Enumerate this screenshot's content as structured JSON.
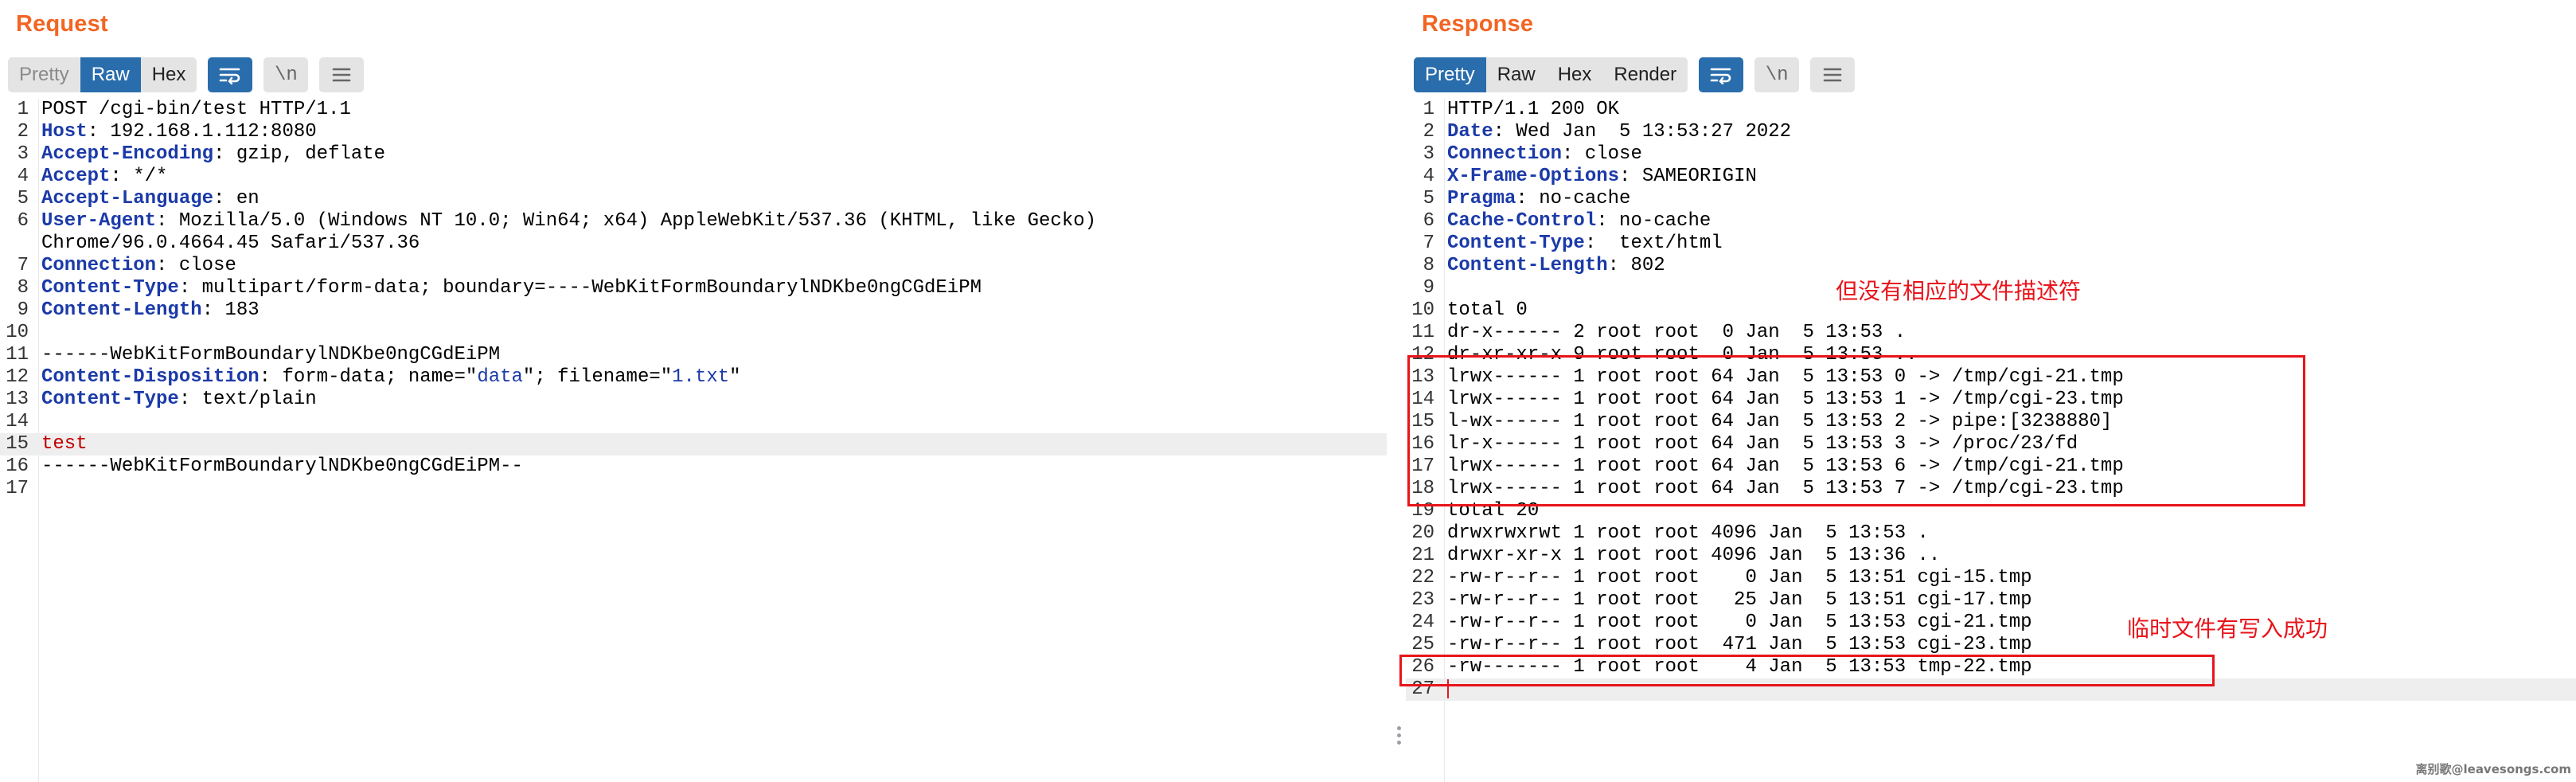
{
  "request": {
    "title": "Request",
    "tabs": [
      "Pretty",
      "Raw",
      "Hex"
    ],
    "icons": [
      "wrap-icon",
      "newline-icon",
      "menu-icon"
    ],
    "newline_glyph": "\\n",
    "lines": [
      {
        "n": "1",
        "key": "",
        "val": "POST /cgi-bin/test HTTP/1.1"
      },
      {
        "n": "2",
        "key": "Host",
        "val": ": 192.168.1.112:8080"
      },
      {
        "n": "3",
        "key": "Accept-Encoding",
        "val": ": gzip, deflate"
      },
      {
        "n": "4",
        "key": "Accept",
        "val": ": */*"
      },
      {
        "n": "5",
        "key": "Accept-Language",
        "val": ": en"
      },
      {
        "n": "6",
        "key": "User-Agent",
        "val": ": Mozilla/5.0 (Windows NT 10.0; Win64; x64) AppleWebKit/537.36 (KHTML, like Gecko)"
      },
      {
        "n": "",
        "key": "",
        "val": "Chrome/96.0.4664.45 Safari/537.36"
      },
      {
        "n": "7",
        "key": "Connection",
        "val": ": close"
      },
      {
        "n": "8",
        "key": "Content-Type",
        "val": ": multipart/form-data; boundary=----WebKitFormBoundarylNDKbe0ngCGdEiPM"
      },
      {
        "n": "9",
        "key": "Content-Length",
        "val": ": 183"
      },
      {
        "n": "10",
        "key": "",
        "val": ""
      },
      {
        "n": "11",
        "key": "",
        "val": "------WebKitFormBoundarylNDKbe0ngCGdEiPM"
      },
      {
        "n": "12",
        "key": "Content-Disposition",
        "val": ": form-data; name=\"",
        "s1": "data",
        "mid": "\"; filename=\"",
        "s2": "1.txt",
        "tail": "\""
      },
      {
        "n": "13",
        "key": "Content-Type",
        "val": ": text/plain"
      },
      {
        "n": "14",
        "key": "",
        "val": ""
      },
      {
        "n": "15",
        "key": "",
        "val": "",
        "red": "test",
        "hl": true
      },
      {
        "n": "16",
        "key": "",
        "val": "------WebKitFormBoundarylNDKbe0ngCGdEiPM--"
      },
      {
        "n": "17",
        "key": "",
        "val": ""
      }
    ]
  },
  "response": {
    "title": "Response",
    "tabs": [
      "Pretty",
      "Raw",
      "Hex",
      "Render"
    ],
    "icons": [
      "wrap-icon",
      "newline-icon",
      "menu-icon"
    ],
    "newline_glyph": "\\n",
    "lines": [
      {
        "n": "1",
        "key": "",
        "val": "HTTP/1.1 200 OK"
      },
      {
        "n": "2",
        "key": "Date",
        "val": ": Wed Jan  5 13:53:27 2022"
      },
      {
        "n": "3",
        "key": "Connection",
        "val": ": close"
      },
      {
        "n": "4",
        "key": "X-Frame-Options",
        "val": ": SAMEORIGIN"
      },
      {
        "n": "5",
        "key": "Pragma",
        "val": ": no-cache"
      },
      {
        "n": "6",
        "key": "Cache-Control",
        "val": ": no-cache"
      },
      {
        "n": "7",
        "key": "Content-Type",
        "val": ":  text/html"
      },
      {
        "n": "8",
        "key": "Content-Length",
        "val": ": 802"
      },
      {
        "n": "9",
        "key": "",
        "val": ""
      },
      {
        "n": "10",
        "key": "",
        "val": "total 0"
      },
      {
        "n": "11",
        "key": "",
        "val": "dr-x------ 2 root root  0 Jan  5 13:53 ."
      },
      {
        "n": "12",
        "key": "",
        "val": "dr-xr-xr-x 9 root root  0 Jan  5 13:53 .."
      },
      {
        "n": "13",
        "key": "",
        "val": "lrwx------ 1 root root 64 Jan  5 13:53 0 -> /tmp/cgi-21.tmp"
      },
      {
        "n": "14",
        "key": "",
        "val": "lrwx------ 1 root root 64 Jan  5 13:53 1 -> /tmp/cgi-23.tmp"
      },
      {
        "n": "15",
        "key": "",
        "val": "l-wx------ 1 root root 64 Jan  5 13:53 2 -> pipe:[3238880]"
      },
      {
        "n": "16",
        "key": "",
        "val": "lr-x------ 1 root root 64 Jan  5 13:53 3 -> /proc/23/fd"
      },
      {
        "n": "17",
        "key": "",
        "val": "lrwx------ 1 root root 64 Jan  5 13:53 6 -> /tmp/cgi-21.tmp"
      },
      {
        "n": "18",
        "key": "",
        "val": "lrwx------ 1 root root 64 Jan  5 13:53 7 -> /tmp/cgi-23.tmp"
      },
      {
        "n": "19",
        "key": "",
        "val": "total 20"
      },
      {
        "n": "20",
        "key": "",
        "val": "drwxrwxrwt 1 root root 4096 Jan  5 13:53 ."
      },
      {
        "n": "21",
        "key": "",
        "val": "drwxr-xr-x 1 root root 4096 Jan  5 13:36 .."
      },
      {
        "n": "22",
        "key": "",
        "val": "-rw-r--r-- 1 root root    0 Jan  5 13:51 cgi-15.tmp"
      },
      {
        "n": "23",
        "key": "",
        "val": "-rw-r--r-- 1 root root   25 Jan  5 13:51 cgi-17.tmp"
      },
      {
        "n": "24",
        "key": "",
        "val": "-rw-r--r-- 1 root root    0 Jan  5 13:53 cgi-21.tmp"
      },
      {
        "n": "25",
        "key": "",
        "val": "-rw-r--r-- 1 root root  471 Jan  5 13:53 cgi-23.tmp"
      },
      {
        "n": "26",
        "key": "",
        "val": "-rw------- 1 root root    4 Jan  5 13:53 tmp-22.tmp"
      },
      {
        "n": "27",
        "key": "",
        "val": "",
        "cursor": true,
        "hl": true
      }
    ]
  },
  "annotations": {
    "note_top": "但没有相应的文件描述符",
    "note_bottom": "临时文件有写入成功",
    "color": "#e8141b"
  },
  "watermark": "离别歌@leavesongs.com",
  "colors": {
    "title": "#f26522",
    "active_tab": "#2a6dac",
    "header_key": "#1b3aa8"
  }
}
